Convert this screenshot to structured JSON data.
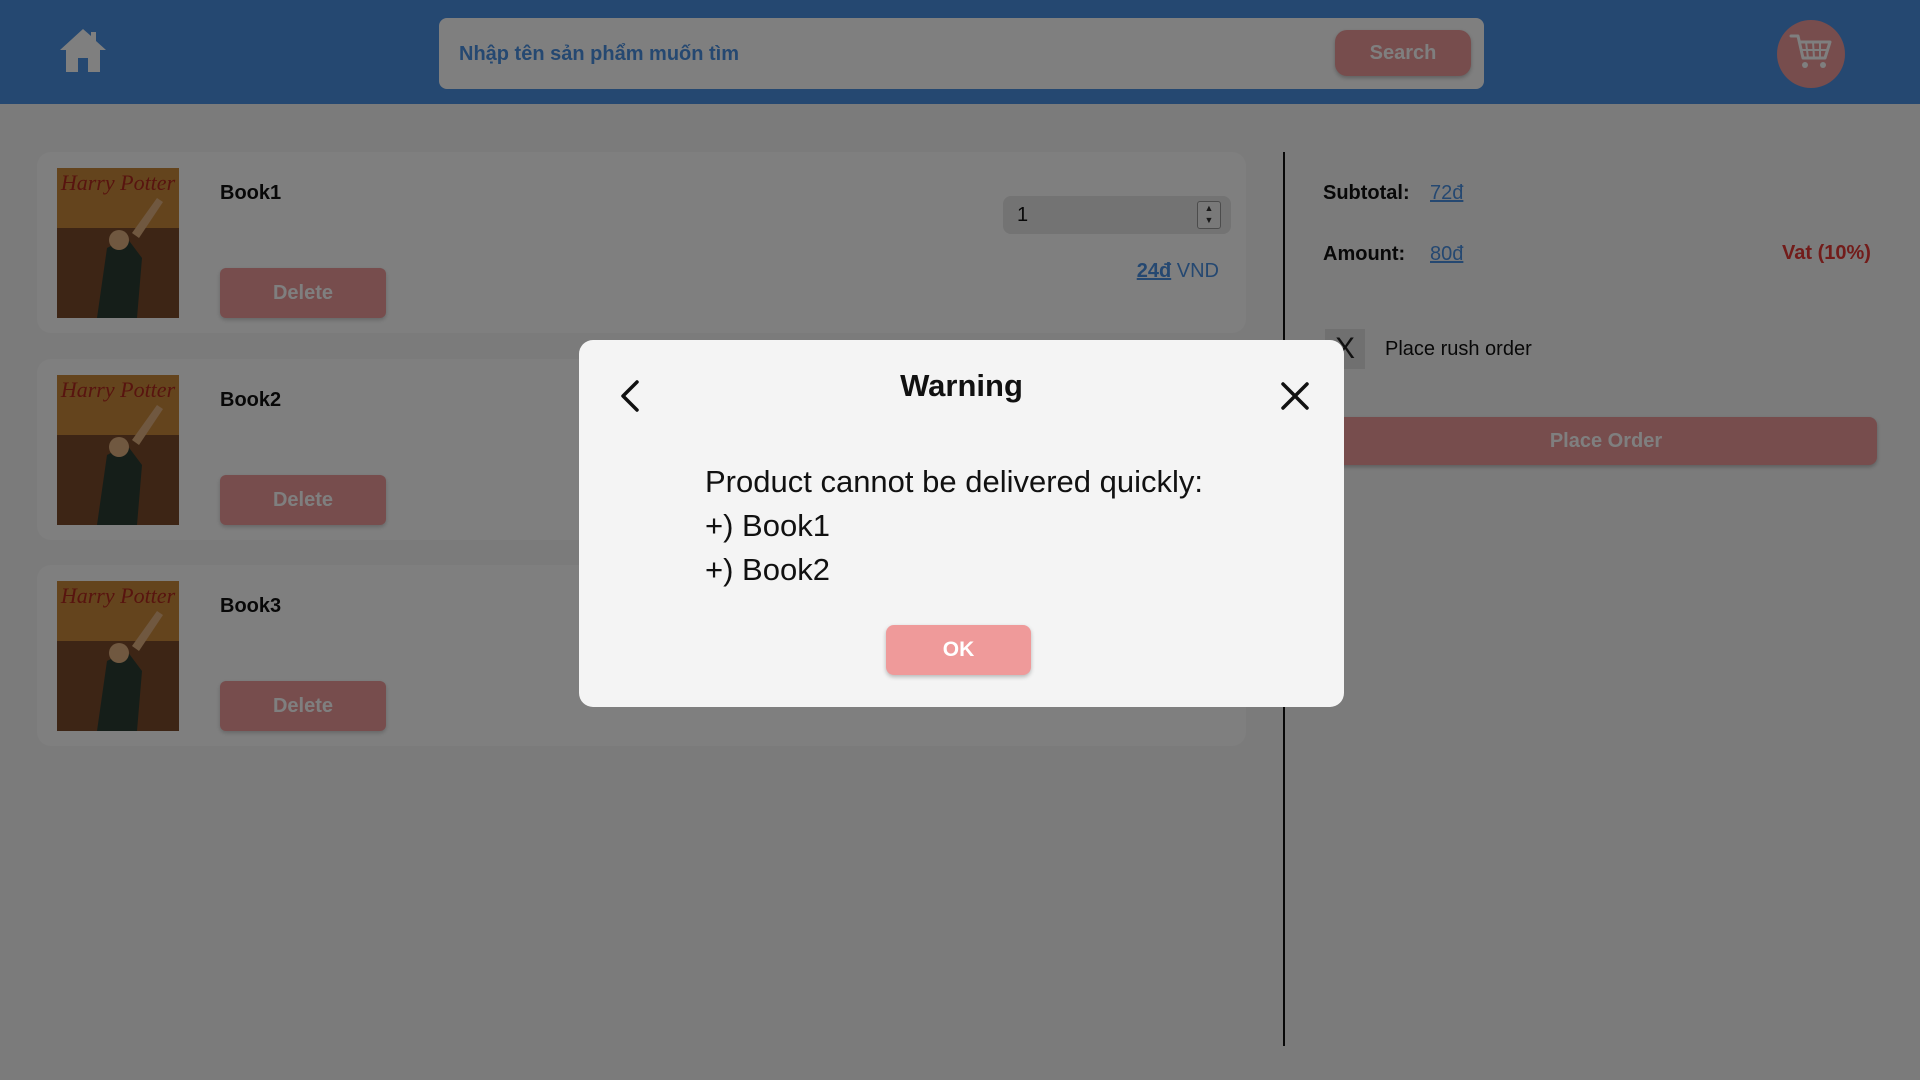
{
  "header": {
    "home_icon": "home-icon",
    "search": {
      "placeholder": "Nhập tên sản phẩm muốn tìm",
      "button_label": "Search"
    },
    "cart_icon": "cart-icon"
  },
  "cart": {
    "items": [
      {
        "name": "Book1",
        "delete_label": "Delete",
        "quantity": "1",
        "price": "24đ",
        "currency": "VND"
      },
      {
        "name": "Book2",
        "delete_label": "Delete"
      },
      {
        "name": "Book3",
        "delete_label": "Delete"
      }
    ]
  },
  "summary": {
    "subtotal_label": "Subtotal:",
    "subtotal_value": "72đ",
    "amount_label": "Amount:",
    "amount_value": "80đ",
    "vat_label": "Vat (10%)",
    "rush_checkbox_mark": "X",
    "rush_label": "Place rush order",
    "place_order_label": "Place Order"
  },
  "modal": {
    "title": "Warning",
    "message": "Product cannot be delivered quickly:",
    "lines": [
      "+) Book1",
      "+) Book2"
    ],
    "ok_label": "OK"
  },
  "colors": {
    "header": "#4a90e2",
    "accent": "#ef9a9a",
    "link": "#4a90e2",
    "vat": "#e53935"
  }
}
